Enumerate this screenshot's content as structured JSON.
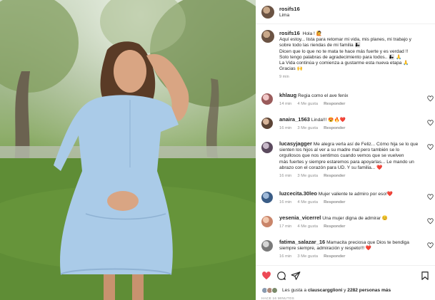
{
  "post": {
    "username": "rosifs16",
    "location": "Lima"
  },
  "caption": {
    "username": "rosifs16",
    "lines": [
      "Hola ! 🙋",
      "Aquí estoy... lista para retomar mi vida, mis planes, mi trabajo y",
      "sobre todo las riendas de mi familia 👩‍👧",
      "Dicen que lo que no te mata te hace más fuerte y es verdad !!",
      "Solo tengo palabras de agradecimiento para todos.. 👩‍👧 🙏",
      "La Vida continúa y comienza a gustarme esta nueva etapa 🙏",
      "Gracias 🙌"
    ],
    "time": "9 min"
  },
  "comments": [
    {
      "user": "khlaug",
      "lines": [
        "Regia como el ave fenix"
      ],
      "time": "14 min",
      "likes": "4 Me gusta",
      "reply": "Responder"
    },
    {
      "user": "anaira_1563",
      "lines": [
        "Linda!!! 😍🔥❤️"
      ],
      "time": "16 min",
      "likes": "3 Me gusta",
      "reply": "Responder"
    },
    {
      "user": "lucasyjagger",
      "lines": [
        "Me alegra verla así de Feliz... Cómo hija se lo que",
        "sienten los hijos al ver a su madre mal pero también se lo",
        "orgullosos que nos sentimos cuando vemos que se vuelven",
        "más fuertes y siempre estaremos para apoyarlas... Le mando un",
        "abrazo con el corazón para UD. Y su familia... ❤️"
      ],
      "time": "16 min",
      "likes": "3 Me gusta",
      "reply": "Responder"
    },
    {
      "user": "luzcecita.30leo",
      "lines": [
        "Mujer valiente te admiro por eso!❤️"
      ],
      "time": "16 min",
      "likes": "4 Me gusta",
      "reply": "Responder"
    },
    {
      "user": "yesenia_vicerrel",
      "lines": [
        "Una mujer digna de admirar 😊"
      ],
      "time": "17 min",
      "likes": "4 Me gusta",
      "reply": "Responder"
    },
    {
      "user": "fatima_salazar_16",
      "lines": [
        "Mamacita preciosa que Dios te bendiga",
        "siempre siempre, admiración y respeto!!! ❤️"
      ],
      "time": "16 min",
      "likes": "3 Me gusta",
      "reply": "Responder"
    }
  ],
  "likes": {
    "prefix": "Les gusta a",
    "user": "clauscargglioni",
    "middle": "y",
    "count": "2282 personas más"
  },
  "posted_ago": "HACE 16 MINUTOS",
  "colors": {
    "heart": "#ed4956",
    "muted": "#8e8e8e"
  },
  "icons": [
    "heart-icon",
    "comment-icon",
    "share-icon",
    "bookmark-icon"
  ]
}
